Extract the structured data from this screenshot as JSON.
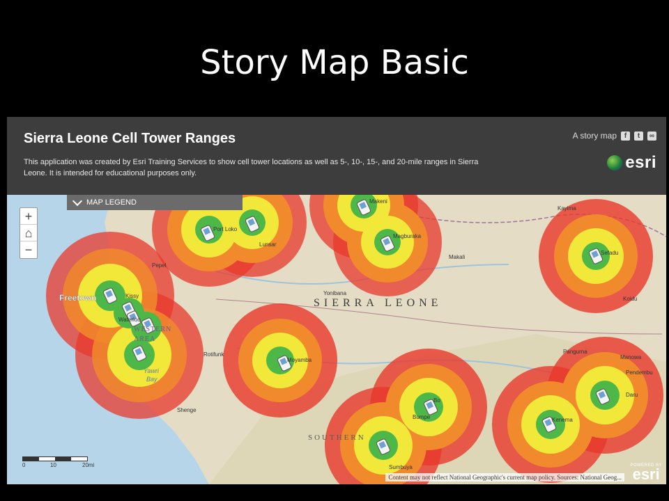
{
  "slide": {
    "title": "Story Map Basic"
  },
  "header": {
    "title": "Sierra Leone Cell Tower Ranges",
    "description": "This application was created by Esri Training Services to show cell tower locations as well as 5-, 10-, 15-, and 20-mile ranges in Sierra Leone. It is intended for educational purposes only.",
    "storymap_label": "A story map",
    "share_icons": [
      "facebook-icon",
      "twitter-icon",
      "link-icon"
    ],
    "logo_text": "esri"
  },
  "legend": {
    "label": "MAP LEGEND"
  },
  "zoom": {
    "in": "+",
    "home": "⌂",
    "out": "−"
  },
  "map": {
    "country_label": "SIERRA LEONE",
    "region_label": "SOUTHERN",
    "area_labels": [
      "WESTERN",
      "AREA"
    ],
    "bay_labels": [
      "Yawri",
      "Bay"
    ],
    "places": [
      "Freetown",
      "Kissy",
      "Pepel",
      "Port Loko",
      "Lunsar",
      "Makeni",
      "Magburaka",
      "Makali",
      "Yonibana",
      "Kayima",
      "Sefadu",
      "Koidu",
      "Rotifunk",
      "Moyamba",
      "Shenge",
      "Bumpe",
      "Bo",
      "Sumbuya",
      "Pangurna",
      "Kenema",
      "Manowa",
      "Pendembu",
      "Daru",
      "Waterloo"
    ],
    "ring_colors": {
      "20mi": "#e8382c",
      "15mi": "#f08a2c",
      "10mi": "#f2e83a",
      "5mi": "#4db848"
    }
  },
  "scalebar": {
    "labels": [
      "0",
      "10",
      "20mi"
    ]
  },
  "attribution": "Content may not reflect National Geographic's current map policy. Sources: National Geog...",
  "powered": {
    "small": "POWERED BY",
    "big": "esri"
  }
}
